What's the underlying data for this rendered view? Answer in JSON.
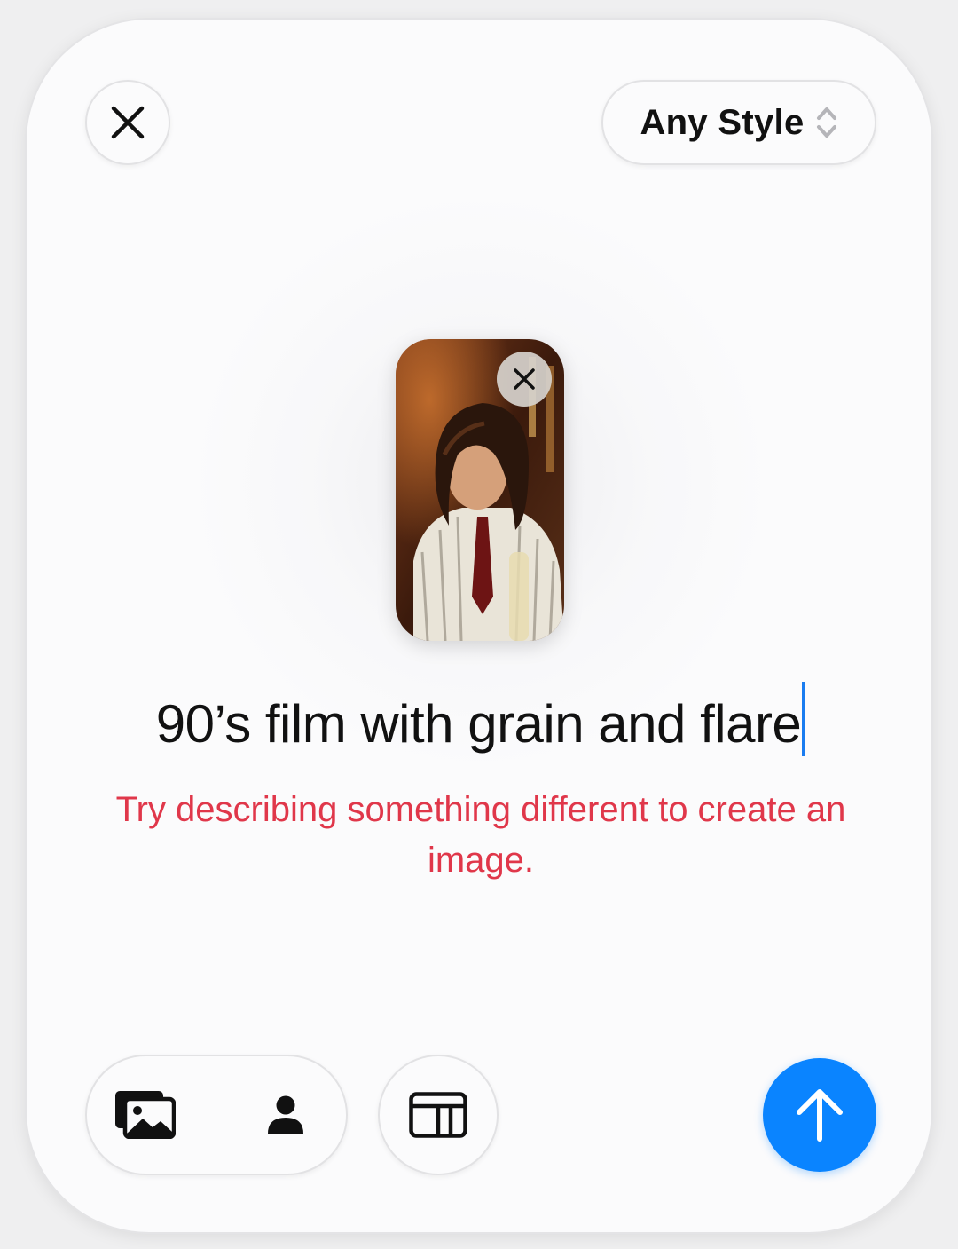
{
  "toolbar": {
    "close_icon": "close-icon",
    "style_picker": {
      "label": "Any Style",
      "icon": "chevron-up-down-icon"
    }
  },
  "reference_photo": {
    "remove_icon": "close-icon",
    "description": "photo of a person with long hair wearing a striped shirt and tie"
  },
  "prompt": {
    "text": "90’s film with grain and flare"
  },
  "error": {
    "message": "Try describing something different to create an image."
  },
  "bottom_bar": {
    "gallery_icon": "photo-library-icon",
    "person_icon": "person-icon",
    "layout_icon": "layout-icon",
    "send_icon": "arrow-up-icon"
  },
  "colors": {
    "accent": "#0a84ff",
    "error": "#e0374a",
    "caret": "#1a7cf0"
  }
}
